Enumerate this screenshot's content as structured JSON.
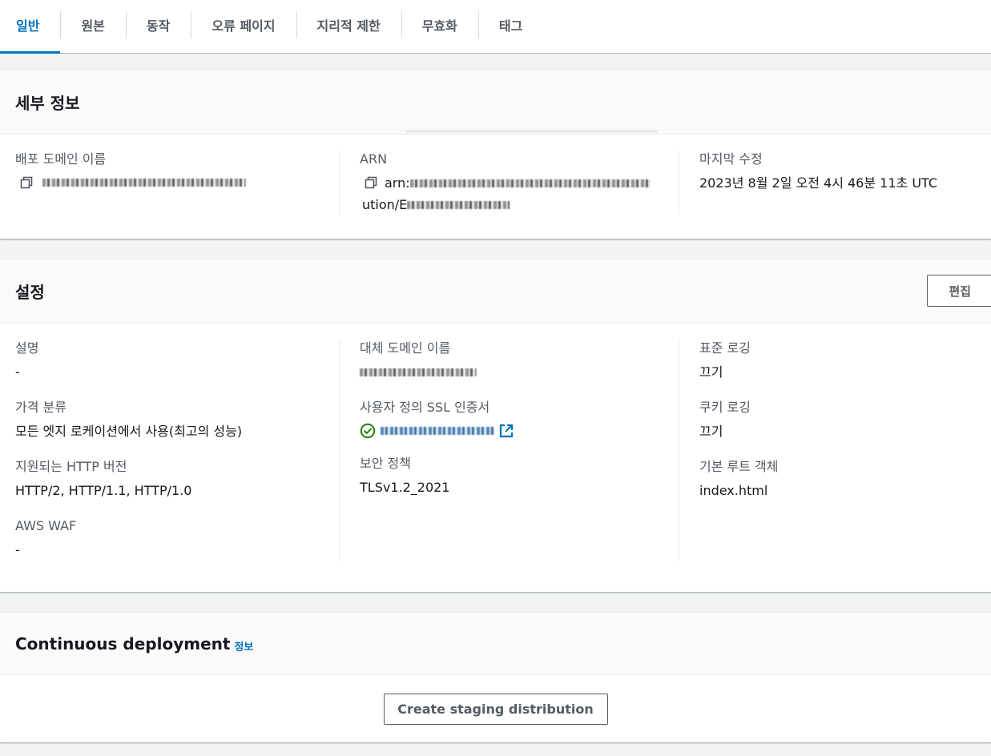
{
  "tabs": [
    {
      "label": "일반",
      "active": true
    },
    {
      "label": "원본"
    },
    {
      "label": "동작"
    },
    {
      "label": "오류 페이지"
    },
    {
      "label": "지리적 제한"
    },
    {
      "label": "무효화"
    },
    {
      "label": "태그"
    }
  ],
  "details": {
    "title": "세부 정보",
    "distribution_domain_label": "배포 도메인 이름",
    "arn_label": "ARN",
    "arn_prefix": "arn:",
    "arn_suffix": "ution/E",
    "last_modified_label": "마지막 수정",
    "last_modified_value": "2023년 8월 2일 오전 4시 46분 11초 UTC"
  },
  "settings": {
    "title": "설정",
    "edit_label": "편집",
    "description_label": "설명",
    "description_value": "-",
    "price_class_label": "가격 분류",
    "price_class_value": "모든 엣지 로케이션에서 사용(최고의 성능)",
    "http_versions_label": "지원되는 HTTP 버전",
    "http_versions_value": "HTTP/2, HTTP/1.1, HTTP/1.0",
    "waf_label": "AWS WAF",
    "waf_value": "-",
    "alt_domain_label": "대체 도메인 이름",
    "ssl_cert_label": "사용자 정의 SSL 인증서",
    "security_policy_label": "보안 정책",
    "security_policy_value": "TLSv1.2_2021",
    "standard_logging_label": "표준 로깅",
    "standard_logging_value": "끄기",
    "cookie_logging_label": "쿠키 로깅",
    "cookie_logging_value": "끄기",
    "default_root_label": "기본 루트 객체",
    "default_root_value": "index.html"
  },
  "continuous_deployment": {
    "title": "Continuous deployment",
    "info_label": "정보",
    "create_staging_label": "Create staging distribution"
  },
  "icons": {
    "copy": "copy-icon",
    "status_ok": "check-circle-icon",
    "external_link": "external-link-icon"
  },
  "colors": {
    "accent": "#0073bb",
    "success": "#1d8102"
  }
}
